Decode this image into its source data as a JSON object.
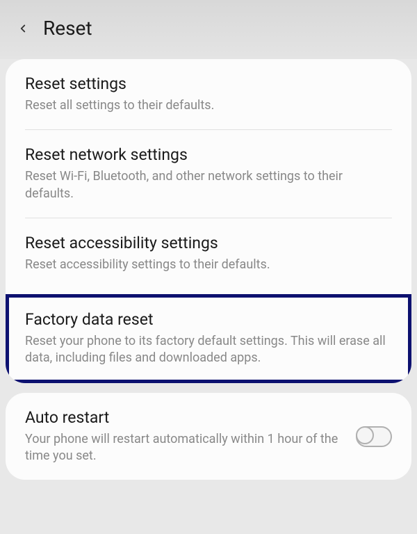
{
  "header": {
    "title": "Reset"
  },
  "items": {
    "reset_settings": {
      "title": "Reset settings",
      "desc": "Reset all settings to their defaults."
    },
    "reset_network": {
      "title": "Reset network settings",
      "desc": "Reset Wi-Fi, Bluetooth, and other network settings to their defaults."
    },
    "reset_accessibility": {
      "title": "Reset accessibility settings",
      "desc": "Reset accessibility settings to their defaults."
    },
    "factory_reset": {
      "title": "Factory data reset",
      "desc": "Reset your phone to its factory default settings. This will erase all data, including files and downloaded apps."
    },
    "auto_restart": {
      "title": "Auto restart",
      "desc": "Your phone will restart automatically within 1 hour of the time you set."
    }
  }
}
